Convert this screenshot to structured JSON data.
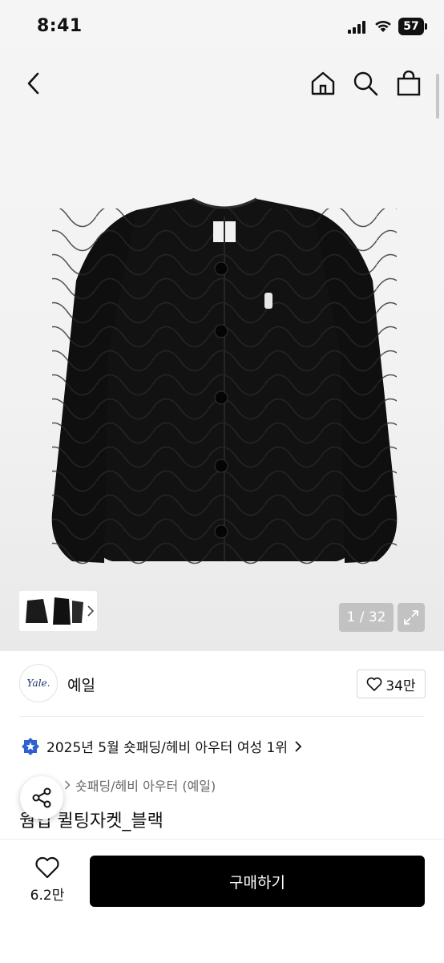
{
  "status": {
    "time": "8:41",
    "battery": "57"
  },
  "gallery": {
    "counter": "1 / 32"
  },
  "brand": {
    "logo_text": "Yale.",
    "name": "예일",
    "likes": "34만"
  },
  "ranking": {
    "text": "2025년 5월 숏패딩/헤비 아우터 여성 1위"
  },
  "breadcrumb": {
    "category": "숏패딩/헤비 아우터 (예일)"
  },
  "product": {
    "name": "웜업 퀼팅자켓_블랙"
  },
  "bottom": {
    "wish_count": "6.2만",
    "buy_label": "구매하기"
  },
  "icons": [
    "back-icon",
    "home-icon",
    "search-icon",
    "shopping-bag-icon",
    "expand-icon",
    "heart-icon",
    "share-icon",
    "ranking-badge-icon",
    "chevron-right-icon"
  ],
  "colors": {
    "buy_button": "#000000",
    "badge": "#2f5fd0",
    "brand_logo": "#1b2f6b"
  }
}
